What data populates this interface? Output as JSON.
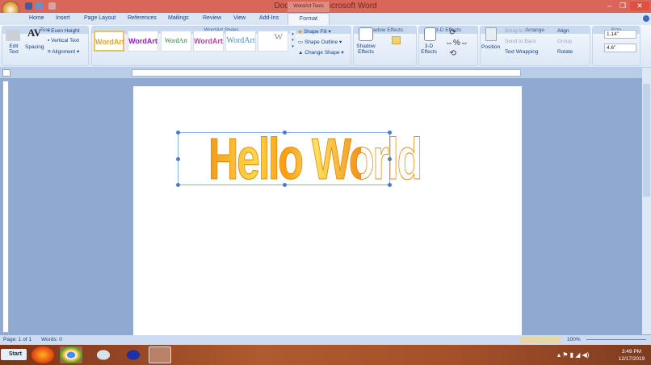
{
  "window": {
    "title": "Document1 - Microsoft Word",
    "context_tab": "WordArt Tools"
  },
  "tabs": [
    "Home",
    "Insert",
    "Page Layout",
    "References",
    "Mailings",
    "Review",
    "View",
    "Add-Ins",
    "Format"
  ],
  "ribbon": {
    "text_group": {
      "label": "Text",
      "edit_text": "Edit Text",
      "spacing": "Spacing",
      "even_height": "Even Height",
      "vertical_text": "Vertical Text",
      "alignment": "Alignment"
    },
    "wordart_styles": {
      "label": "WordArt Styles",
      "items": [
        "WordArt",
        "WordArt",
        "WordArt",
        "WordArt",
        "WordArt",
        "W"
      ],
      "shape_fill": "Shape Fill",
      "shape_outline": "Shape Outline",
      "change_shape": "Change Shape"
    },
    "shadow": {
      "label": "Shadow Effects",
      "button": "Shadow Effects"
    },
    "threed": {
      "label": "3-D Effects",
      "button": "3-D Effects"
    },
    "arrange": {
      "label": "Arrange",
      "position": "Position",
      "bring_front": "Bring to Front",
      "send_back": "Send to Back",
      "text_wrapping": "Text Wrapping",
      "align": "Align",
      "group": "Group",
      "rotate": "Rotate"
    },
    "size": {
      "label": "Size",
      "height": "1.14\"",
      "width": "4.6\""
    }
  },
  "document": {
    "wordart_text": "Hello World"
  },
  "status": {
    "page": "Page: 1 of 1",
    "words": "Words: 0",
    "zoom": "100%"
  },
  "taskbar": {
    "start": "Start",
    "time": "3:49 PM",
    "date": "12/17/2019"
  },
  "colors": {
    "titlebar": "#d8675a",
    "ribbon": "#dce7f5",
    "workspace": "#8fa9d0",
    "taskbar": "#a5502a"
  }
}
